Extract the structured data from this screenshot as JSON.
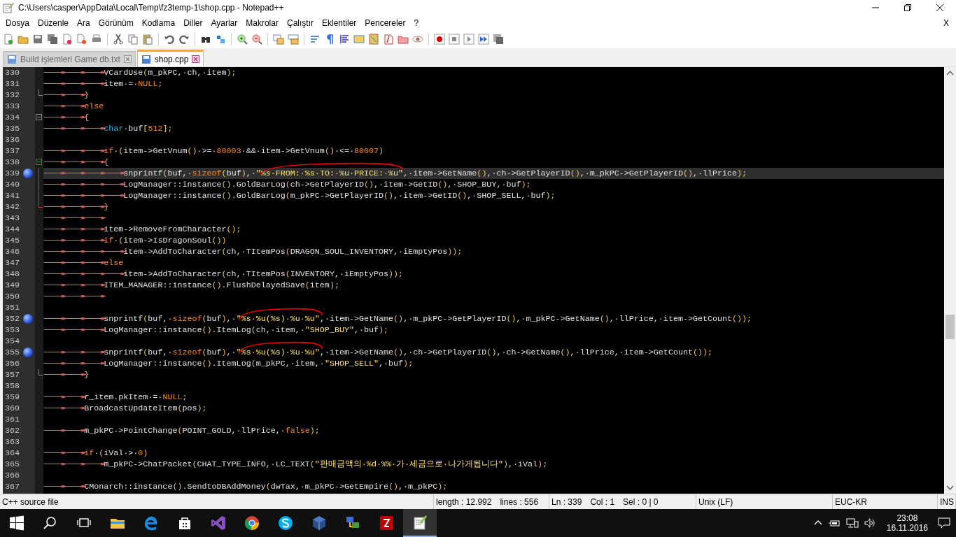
{
  "window": {
    "title": "C:\\Users\\casper\\AppData\\Local\\Temp\\fz3temp-1\\shop.cpp - Notepad++"
  },
  "menu": [
    "Dosya",
    "Düzenle",
    "Ara",
    "Görünüm",
    "Kodlama",
    "Diller",
    "Ayarlar",
    "Makrolar",
    "Çalıştır",
    "Eklentiler",
    "Pencereler",
    "?"
  ],
  "menu_close": "X",
  "tabs": [
    {
      "label": "Build işlemleri Game db.txt",
      "selected": false
    },
    {
      "label": "shop.cpp",
      "selected": true
    }
  ],
  "lines": [
    {
      "number": "330",
      "bookmark": false,
      "current": false,
      "tokens": [
        {
          "kind": "tab",
          "text": "⟶⟶⟶"
        },
        {
          "kind": "plain",
          "text": "VCardUse(m_pkPC,·ch,·item);"
        }
      ]
    },
    {
      "number": "331",
      "bookmark": false,
      "current": false,
      "tokens": [
        {
          "kind": "tab",
          "text": "⟶⟶⟶"
        },
        {
          "kind": "plain",
          "text": "item·=·"
        },
        {
          "kind": "keyword",
          "text": "NULL"
        },
        {
          "kind": "plain",
          "text": ";"
        }
      ]
    },
    {
      "number": "332",
      "bookmark": false,
      "current": false,
      "fold": {
        "kind": "end",
        "active": false
      },
      "tokens": [
        {
          "kind": "tab",
          "text": "⟶⟶"
        },
        {
          "kind": "plain",
          "text": "}"
        }
      ]
    },
    {
      "number": "333",
      "bookmark": false,
      "current": false,
      "tokens": [
        {
          "kind": "tab",
          "text": "⟶⟶"
        },
        {
          "kind": "keyword",
          "text": "else"
        }
      ]
    },
    {
      "number": "334",
      "bookmark": false,
      "current": false,
      "fold": {
        "kind": "start",
        "active": false
      },
      "tokens": [
        {
          "kind": "tab",
          "text": "⟶⟶"
        },
        {
          "kind": "plain",
          "text": "{"
        }
      ]
    },
    {
      "number": "335",
      "bookmark": false,
      "current": false,
      "tokens": [
        {
          "kind": "tab",
          "text": "⟶⟶⟶"
        },
        {
          "kind": "type",
          "text": "char"
        },
        {
          "kind": "plain",
          "text": "·buf["
        },
        {
          "kind": "number",
          "text": "512"
        },
        {
          "kind": "plain",
          "text": "];"
        }
      ]
    },
    {
      "number": "336",
      "bookmark": false,
      "current": false
    },
    {
      "number": "337",
      "bookmark": false,
      "current": false,
      "tokens": [
        {
          "kind": "tab",
          "text": "⟶⟶⟶"
        },
        {
          "kind": "keyword",
          "text": "if"
        },
        {
          "kind": "plain",
          "text": "·(item->GetVnum()·>=·"
        },
        {
          "kind": "number",
          "text": "80003"
        },
        {
          "kind": "plain",
          "text": "·&&·item->GetVnum()·<=·"
        },
        {
          "kind": "number",
          "text": "80007"
        },
        {
          "kind": "plain",
          "text": ")"
        }
      ]
    },
    {
      "number": "338",
      "bookmark": false,
      "current": false,
      "fold": {
        "kind": "start",
        "active": true
      },
      "tokens": [
        {
          "kind": "tab",
          "text": "⟶⟶⟶"
        },
        {
          "kind": "plain",
          "text": "{"
        }
      ]
    },
    {
      "number": "339",
      "bookmark": true,
      "current": true,
      "fold": {
        "kind": "line",
        "active": true
      },
      "tokens": [
        {
          "kind": "tab",
          "text": "⟶⟶⟶⟶"
        },
        {
          "kind": "plain",
          "text": "snprintf(buf,·"
        },
        {
          "kind": "keyword",
          "text": "sizeof"
        },
        {
          "kind": "plain",
          "text": "(buf),·"
        },
        {
          "kind": "string",
          "text": "\"%s·FROM:·%s·TO:·%u·PRICE:·%u\"",
          "circled": true
        },
        {
          "kind": "plain",
          "text": ",·item->GetName(),·ch->GetPlayerID(),·m_pkPC->GetPlayerID(),·llPrice);"
        }
      ]
    },
    {
      "number": "340",
      "bookmark": false,
      "current": false,
      "fold": {
        "kind": "line",
        "active": true
      },
      "tokens": [
        {
          "kind": "tab",
          "text": "⟶⟶⟶⟶"
        },
        {
          "kind": "plain",
          "text": "LogManager::instance().GoldBarLog(ch->GetPlayerID(),·item->GetID(),·SHOP_BUY,·buf);"
        }
      ]
    },
    {
      "number": "341",
      "bookmark": false,
      "current": false,
      "fold": {
        "kind": "line",
        "active": true
      },
      "tokens": [
        {
          "kind": "tab",
          "text": "⟶⟶⟶⟶"
        },
        {
          "kind": "plain",
          "text": "LogManager::instance().GoldBarLog(m_pkPC->GetPlayerID(),·item->GetID(),·SHOP_SELL,·buf);"
        }
      ]
    },
    {
      "number": "342",
      "bookmark": false,
      "current": false,
      "fold": {
        "kind": "end",
        "active": true
      },
      "tokens": [
        {
          "kind": "tab",
          "text": "⟶⟶⟶"
        },
        {
          "kind": "plain",
          "text": "}"
        }
      ]
    },
    {
      "number": "343",
      "bookmark": false,
      "current": false,
      "tokens": [
        {
          "kind": "tab",
          "text": "⟶⟶⟶"
        }
      ]
    },
    {
      "number": "344",
      "bookmark": false,
      "current": false,
      "tokens": [
        {
          "kind": "tab",
          "text": "⟶⟶⟶"
        },
        {
          "kind": "plain",
          "text": "item->RemoveFromCharacter();"
        }
      ]
    },
    {
      "number": "345",
      "bookmark": false,
      "current": false,
      "tokens": [
        {
          "kind": "tab",
          "text": "⟶⟶⟶"
        },
        {
          "kind": "keyword",
          "text": "if"
        },
        {
          "kind": "plain",
          "text": "·(item->IsDragonSoul())"
        }
      ]
    },
    {
      "number": "346",
      "bookmark": false,
      "current": false,
      "tokens": [
        {
          "kind": "tab",
          "text": "⟶⟶⟶⟶"
        },
        {
          "kind": "plain",
          "text": "item->AddToCharacter(ch,·TItemPos(DRAGON_SOUL_INVENTORY,·iEmptyPos));"
        }
      ]
    },
    {
      "number": "347",
      "bookmark": false,
      "current": false,
      "tokens": [
        {
          "kind": "tab",
          "text": "⟶⟶⟶"
        },
        {
          "kind": "keyword",
          "text": "else"
        }
      ]
    },
    {
      "number": "348",
      "bookmark": false,
      "current": false,
      "tokens": [
        {
          "kind": "tab",
          "text": "⟶⟶⟶⟶"
        },
        {
          "kind": "plain",
          "text": "item->AddToCharacter(ch,·TItemPos(INVENTORY,·iEmptyPos));"
        }
      ]
    },
    {
      "number": "349",
      "bookmark": false,
      "current": false,
      "tokens": [
        {
          "kind": "tab",
          "text": "⟶⟶⟶"
        },
        {
          "kind": "plain",
          "text": "ITEM_MANAGER::instance().FlushDelayedSave(item);"
        }
      ]
    },
    {
      "number": "350",
      "bookmark": false,
      "current": false,
      "tokens": [
        {
          "kind": "tab",
          "text": "⟶⟶⟶"
        }
      ]
    },
    {
      "number": "351",
      "bookmark": false,
      "current": false
    },
    {
      "number": "352",
      "bookmark": true,
      "current": false,
      "tokens": [
        {
          "kind": "tab",
          "text": "⟶⟶⟶"
        },
        {
          "kind": "plain",
          "text": "snprintf(buf,·"
        },
        {
          "kind": "keyword",
          "text": "sizeof"
        },
        {
          "kind": "plain",
          "text": "(buf),·"
        },
        {
          "kind": "string",
          "text": "\"%s·%u(%s)·%u·%u\"",
          "circled": true
        },
        {
          "kind": "plain",
          "text": ",·item->GetName(),·m_pkPC->GetPlayerID(),·m_pkPC->GetName(),·llPrice,·item->GetCount());"
        }
      ]
    },
    {
      "number": "353",
      "bookmark": false,
      "current": false,
      "tokens": [
        {
          "kind": "tab",
          "text": "⟶⟶⟶"
        },
        {
          "kind": "plain",
          "text": "LogManager::instance().ItemLog(ch,·item,·"
        },
        {
          "kind": "string",
          "text": "\"SHOP_BUY\""
        },
        {
          "kind": "plain",
          "text": ",·buf);"
        }
      ]
    },
    {
      "number": "354",
      "bookmark": false,
      "current": false
    },
    {
      "number": "355",
      "bookmark": true,
      "current": false,
      "tokens": [
        {
          "kind": "tab",
          "text": "⟶⟶⟶"
        },
        {
          "kind": "plain",
          "text": "snprintf(buf,·"
        },
        {
          "kind": "keyword",
          "text": "sizeof"
        },
        {
          "kind": "plain",
          "text": "(buf),·"
        },
        {
          "kind": "string",
          "text": "\"%s·%u(%s)·%u·%u\"",
          "circled": true
        },
        {
          "kind": "plain",
          "text": ",·item->GetName(),·ch->GetPlayerID(),·ch->GetName(),·llPrice,·item->GetCount());"
        }
      ]
    },
    {
      "number": "356",
      "bookmark": false,
      "current": false,
      "tokens": [
        {
          "kind": "tab",
          "text": "⟶⟶⟶"
        },
        {
          "kind": "plain",
          "text": "LogManager::instance().ItemLog(m_pkPC,·item,·"
        },
        {
          "kind": "string",
          "text": "\"SHOP_SELL\""
        },
        {
          "kind": "plain",
          "text": ",·buf);"
        }
      ]
    },
    {
      "number": "357",
      "bookmark": false,
      "current": false,
      "fold": {
        "kind": "end",
        "active": false
      },
      "tokens": [
        {
          "kind": "tab",
          "text": "⟶⟶"
        },
        {
          "kind": "plain",
          "text": "}"
        }
      ]
    },
    {
      "number": "358",
      "bookmark": false,
      "current": false
    },
    {
      "number": "359",
      "bookmark": false,
      "current": false,
      "tokens": [
        {
          "kind": "tab",
          "text": "⟶⟶"
        },
        {
          "kind": "plain",
          "text": "r_item.pkItem·=·"
        },
        {
          "kind": "keyword",
          "text": "NULL"
        },
        {
          "kind": "plain",
          "text": ";"
        }
      ]
    },
    {
      "number": "360",
      "bookmark": false,
      "current": false,
      "tokens": [
        {
          "kind": "tab",
          "text": "⟶⟶"
        },
        {
          "kind": "plain",
          "text": "BroadcastUpdateItem(pos);"
        }
      ]
    },
    {
      "number": "361",
      "bookmark": false,
      "current": false
    },
    {
      "number": "362",
      "bookmark": false,
      "current": false,
      "tokens": [
        {
          "kind": "tab",
          "text": "⟶⟶"
        },
        {
          "kind": "plain",
          "text": "m_pkPC->PointChange(POINT_GOLD,·llPrice,·"
        },
        {
          "kind": "keyword",
          "text": "false"
        },
        {
          "kind": "plain",
          "text": ");"
        }
      ]
    },
    {
      "number": "363",
      "bookmark": false,
      "current": false
    },
    {
      "number": "364",
      "bookmark": false,
      "current": false,
      "tokens": [
        {
          "kind": "tab",
          "text": "⟶⟶"
        },
        {
          "kind": "keyword",
          "text": "if"
        },
        {
          "kind": "plain",
          "text": "·(iVal·>·"
        },
        {
          "kind": "number",
          "text": "0"
        },
        {
          "kind": "plain",
          "text": ")"
        }
      ]
    },
    {
      "number": "365",
      "bookmark": false,
      "current": false,
      "tokens": [
        {
          "kind": "tab",
          "text": "⟶⟶⟶"
        },
        {
          "kind": "plain",
          "text": "m_pkPC->ChatPacket(CHAT_TYPE_INFO,·LC_TEXT("
        },
        {
          "kind": "string",
          "text": "\"판매금액의·%d·%%·가·세금으로·나가게됩니다\""
        },
        {
          "kind": "plain",
          "text": "),·iVal);"
        }
      ]
    },
    {
      "number": "366",
      "bookmark": false,
      "current": false
    },
    {
      "number": "367",
      "bookmark": false,
      "current": false,
      "tokens": [
        {
          "kind": "tab",
          "text": "⟶⟶"
        },
        {
          "kind": "plain",
          "text": "CMonarch::instance().SendtoDBAddMoney(dwTax,·m_pkPC->GetEmpire(),·m_pkPC);"
        }
      ]
    }
  ],
  "status_bar": [
    {
      "items": [
        "C++ source file"
      ]
    },
    {
      "items": [
        "length : 12.992",
        "lines : 556"
      ]
    },
    {
      "items": [
        "Ln : 339",
        "Col : 1",
        "Sel : 0 | 0"
      ]
    },
    {
      "items": [
        "Unix (LF)"
      ]
    },
    {
      "items": [
        "EUC-KR"
      ]
    },
    {
      "items": [
        "INS"
      ]
    }
  ],
  "taskbar": {
    "items": [
      {
        "kind": "start",
        "selected": false
      },
      {
        "kind": "search",
        "selected": false
      },
      {
        "kind": "taskview",
        "selected": false
      },
      {
        "kind": "explorer",
        "selected": false
      },
      {
        "kind": "edge",
        "selected": false
      },
      {
        "kind": "store",
        "selected": false
      },
      {
        "kind": "visualstudio",
        "selected": false
      },
      {
        "kind": "chrome",
        "selected": false
      },
      {
        "kind": "skype",
        "selected": false
      },
      {
        "kind": "virtualbox",
        "selected": false
      },
      {
        "kind": "network",
        "selected": false
      },
      {
        "kind": "filezilla",
        "selected": false
      },
      {
        "kind": "notepad",
        "selected": true
      }
    ],
    "clock": {
      "time": "23:08",
      "date": "16.11.2016"
    }
  }
}
